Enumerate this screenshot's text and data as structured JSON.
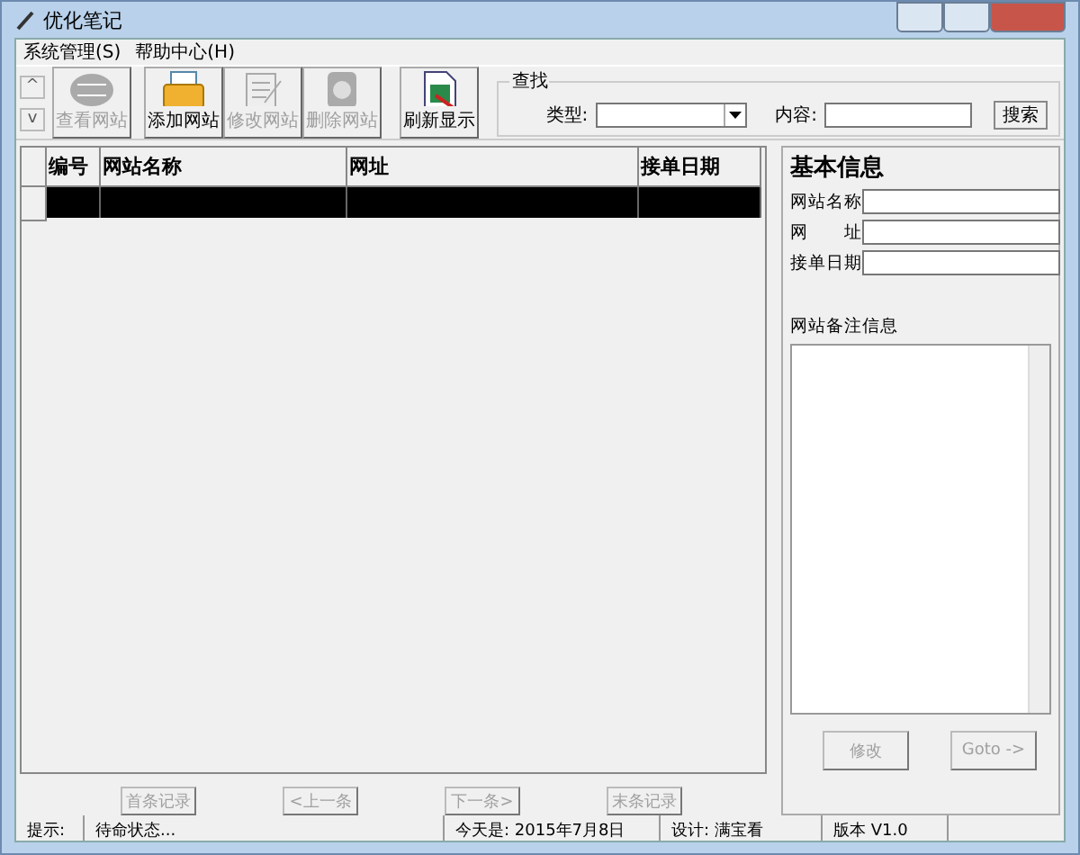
{
  "window": {
    "title": "优化笔记"
  },
  "menu": [
    "系统管理(S)",
    "帮助中心(H)"
  ],
  "scroll_arrows": [
    "^",
    "v"
  ],
  "toolbar": [
    {
      "label": "查看网站",
      "disabled": true,
      "kind": "globe"
    },
    {
      "label": "添加网站",
      "disabled": false,
      "kind": "folder"
    },
    {
      "label": "修改网站",
      "disabled": true,
      "kind": "notepad"
    },
    {
      "label": "删除网站",
      "disabled": true,
      "kind": "book"
    },
    {
      "label": "刷新显示",
      "disabled": false,
      "kind": "document"
    }
  ],
  "search": {
    "title": "查找",
    "type_label": "类型:",
    "content_label": "内容:",
    "button": "搜索"
  },
  "table": {
    "columns": [
      "编号",
      "网站名称",
      "网址",
      "接单日期"
    ]
  },
  "info": {
    "title": "基本信息",
    "fields": [
      "网站名称",
      "网　　址",
      "接单日期"
    ],
    "notes_label": "网站备注信息",
    "buttons": [
      {
        "label": "修改",
        "disabled": true
      },
      {
        "label": "Goto ->",
        "disabled": true
      }
    ]
  },
  "nav": [
    {
      "label": "首条记录",
      "disabled": true
    },
    {
      "label": "<上一条",
      "disabled": true
    },
    {
      "label": "下一条>",
      "disabled": true
    },
    {
      "label": "末条记录",
      "disabled": true
    }
  ],
  "status_bar": [
    "提示:",
    "待命状态...",
    "今天是: 2015年7月8日",
    "设计: 满宝看",
    "版本 V1.0"
  ]
}
